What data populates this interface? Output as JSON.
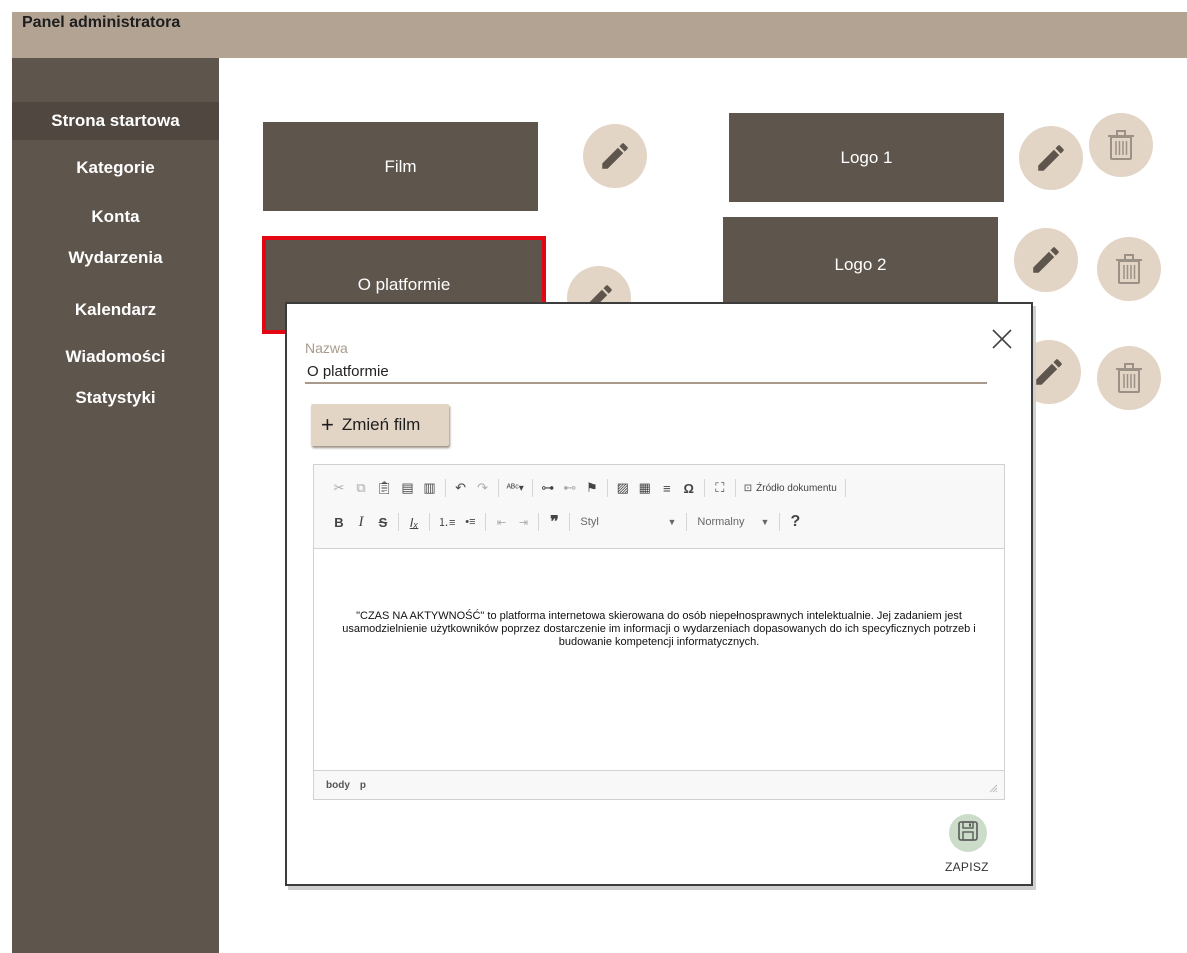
{
  "header": {
    "title": "Panel administratora"
  },
  "sidebar": {
    "items": [
      {
        "label": "Strona startowa",
        "active": true
      },
      {
        "label": "Kategorie"
      },
      {
        "label": "Konta"
      },
      {
        "label": "Wydarzenia"
      },
      {
        "label": "Kalendarz"
      },
      {
        "label": "Wiadomości"
      },
      {
        "label": "Statystyki"
      }
    ]
  },
  "tiles": {
    "film": "Film",
    "about": "O platformie",
    "logo1": "Logo 1",
    "logo2": "Logo 2"
  },
  "icons": {
    "edit": "pencil-icon",
    "delete": "trash-icon",
    "close": "close-icon",
    "save": "floppy-disk-icon"
  },
  "modal": {
    "name_label": "Nazwa",
    "name_value": "O platformie",
    "change_button": "Zmień film",
    "change_icon": "+",
    "editor": {
      "source_label": "Źródło dokumentu",
      "style_combo": "Styl",
      "format_combo": "Normalny",
      "help": "?",
      "content": "\"CZAS NA AKTYWNOŚĆ\" to platforma internetowa skierowana do osób niepełnosprawnych intelektualnie. Jej zadaniem jest usamodzielnienie użytkowników poprzez dostarczenie im informacji o wydarzeniach dopasowanych do ich specyficznych potrzeb i budowanie kompetencji informatycznych.",
      "path": [
        "body",
        "p"
      ]
    },
    "save_label": "ZAPISZ"
  },
  "colors": {
    "header": "#b3a393",
    "sidebar": "#5e554d",
    "tile": "#5e554d",
    "accent_beige": "#e2d5c5",
    "selected_outline": "#e30613",
    "save_green": "#cbdcc8"
  }
}
